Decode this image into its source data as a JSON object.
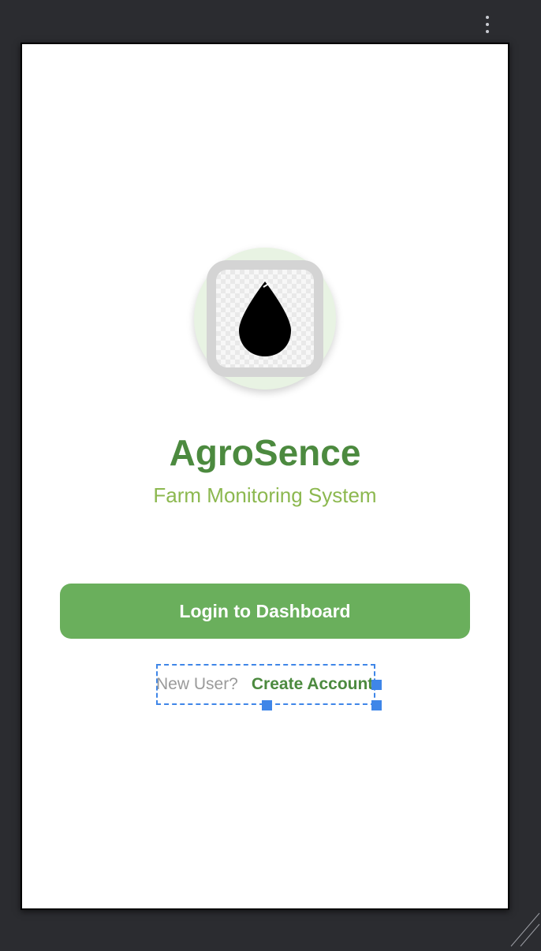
{
  "toolbar": {
    "overflow_icon": "more-vert-icon"
  },
  "app": {
    "logo_icon": "water-drop-icon",
    "title": "AgroSence",
    "subtitle": "Farm Monitoring System"
  },
  "actions": {
    "login_label": "Login to Dashboard",
    "new_user_text": "New User?",
    "create_account_label": "Create Account"
  },
  "colors": {
    "canvas_background": "#2b2c30",
    "primary_green": "#4c8a3f",
    "button_green": "#6aaf5c",
    "subtitle_green": "#8cb84f",
    "selection_blue": "#3f86e8",
    "logo_circle_bg": "#e8f3e3"
  }
}
